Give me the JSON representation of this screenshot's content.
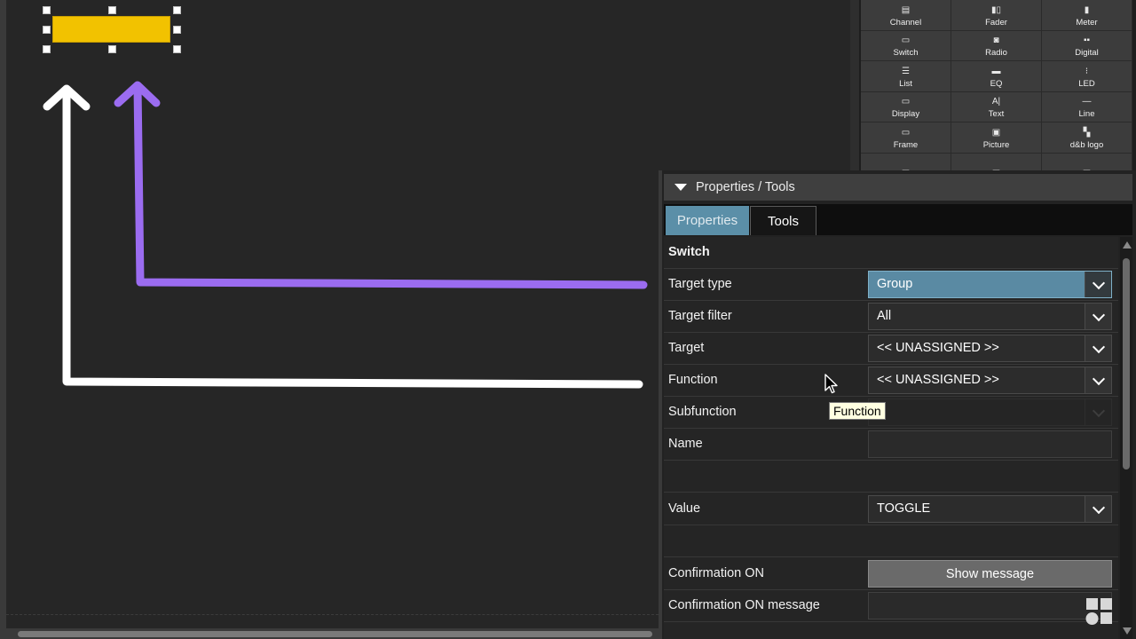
{
  "palette": {
    "items": [
      {
        "label": "Channel",
        "icon": "channel-icon",
        "glyph": "▤"
      },
      {
        "label": "Fader",
        "icon": "fader-icon",
        "glyph": "▮▯"
      },
      {
        "label": "Meter",
        "icon": "meter-icon",
        "glyph": "▮"
      },
      {
        "label": "Switch",
        "icon": "switch-icon",
        "glyph": "▭"
      },
      {
        "label": "Radio",
        "icon": "radio-icon",
        "glyph": "◙"
      },
      {
        "label": "Digital",
        "icon": "digital-icon",
        "glyph": "▪▪"
      },
      {
        "label": "List",
        "icon": "list-icon",
        "glyph": "☰"
      },
      {
        "label": "EQ",
        "icon": "eq-icon",
        "glyph": "▬"
      },
      {
        "label": "LED",
        "icon": "led-icon",
        "glyph": "⁝"
      },
      {
        "label": "Display",
        "icon": "display-icon",
        "glyph": "▭"
      },
      {
        "label": "Text",
        "icon": "text-icon",
        "glyph": "A|"
      },
      {
        "label": "Line",
        "icon": "line-icon",
        "glyph": "—"
      },
      {
        "label": "Frame",
        "icon": "frame-icon",
        "glyph": "▭"
      },
      {
        "label": "Picture",
        "icon": "picture-icon",
        "glyph": "▣"
      },
      {
        "label": "d&b logo",
        "icon": "db-logo-icon",
        "glyph": "▚"
      },
      {
        "label": "",
        "icon": "table-icon",
        "glyph": "▤"
      },
      {
        "label": "",
        "icon": "table-icon",
        "glyph": "▤"
      },
      {
        "label": "",
        "icon": "checker-icon",
        "glyph": "▩"
      }
    ]
  },
  "properties": {
    "header_title": "Properties / Tools",
    "tabs": {
      "properties": "Properties",
      "tools": "Tools"
    },
    "section_title": "Switch",
    "target_type": {
      "label": "Target type",
      "value": "Group"
    },
    "target_filter": {
      "label": "Target filter",
      "value": "All"
    },
    "target": {
      "label": "Target",
      "value": "<< UNASSIGNED >>"
    },
    "function": {
      "label": "Function",
      "value": "<< UNASSIGNED >>"
    },
    "subfunction": {
      "label": "Subfunction",
      "value": ""
    },
    "name": {
      "label": "Name",
      "value": ""
    },
    "value": {
      "label": "Value",
      "value": "TOGGLE"
    },
    "confirmation_on": {
      "label": "Confirmation ON",
      "value": "Show message"
    },
    "confirmation_on_message": {
      "label": "Confirmation ON message",
      "value": ""
    }
  },
  "tooltip": {
    "text": "Function"
  },
  "colors": {
    "widget_yellow": "#f2c200",
    "arrow_white": "#ffffff",
    "arrow_purple": "#9b6cf0",
    "tab_active": "#5b8fa8",
    "dropdown_active": "#5a8aa3"
  }
}
